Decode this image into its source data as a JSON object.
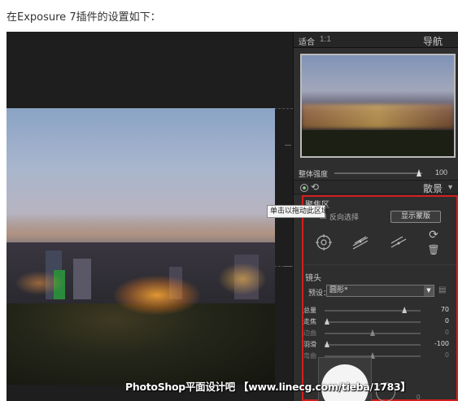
{
  "caption": "在Exposure 7插件的设置如下：",
  "tooltip": "单击以拖动此区域",
  "navigator": {
    "fit_label": "适合",
    "ratio_label": "1:1",
    "title": "导航"
  },
  "strength": {
    "label": "整体强度",
    "value": "100",
    "level": 1.0
  },
  "bokeh_panel": {
    "title": "散景"
  },
  "focus_area": {
    "title": "聚焦区",
    "checkbox_label": "反向选择",
    "show_mask_button": "显示蒙版",
    "tool_icons": [
      "radial-focus-icon",
      "linear-focus-icon",
      "tilt-focus-icon",
      "rotate-icon",
      "trash-icon"
    ]
  },
  "lens": {
    "title": "镜头",
    "preset_label": "预设：",
    "preset_value": "圆形*",
    "sliders": [
      {
        "name": "总量",
        "value": "70",
        "level": 0.85,
        "dim": false
      },
      {
        "name": "走焦",
        "value": "0",
        "level": 0.0,
        "dim": false
      },
      {
        "name": "边曲",
        "value": "0",
        "level": 0.5,
        "dim": true
      },
      {
        "name": "羽滑",
        "value": "-100",
        "level": 0.0,
        "dim": false
      },
      {
        "name": "弯曲",
        "value": "0",
        "level": 0.5,
        "dim": true
      }
    ],
    "shape_value": "0"
  },
  "watermark": "PhotoShop平面设计吧 【www.linecg.com/tieba/1783】"
}
